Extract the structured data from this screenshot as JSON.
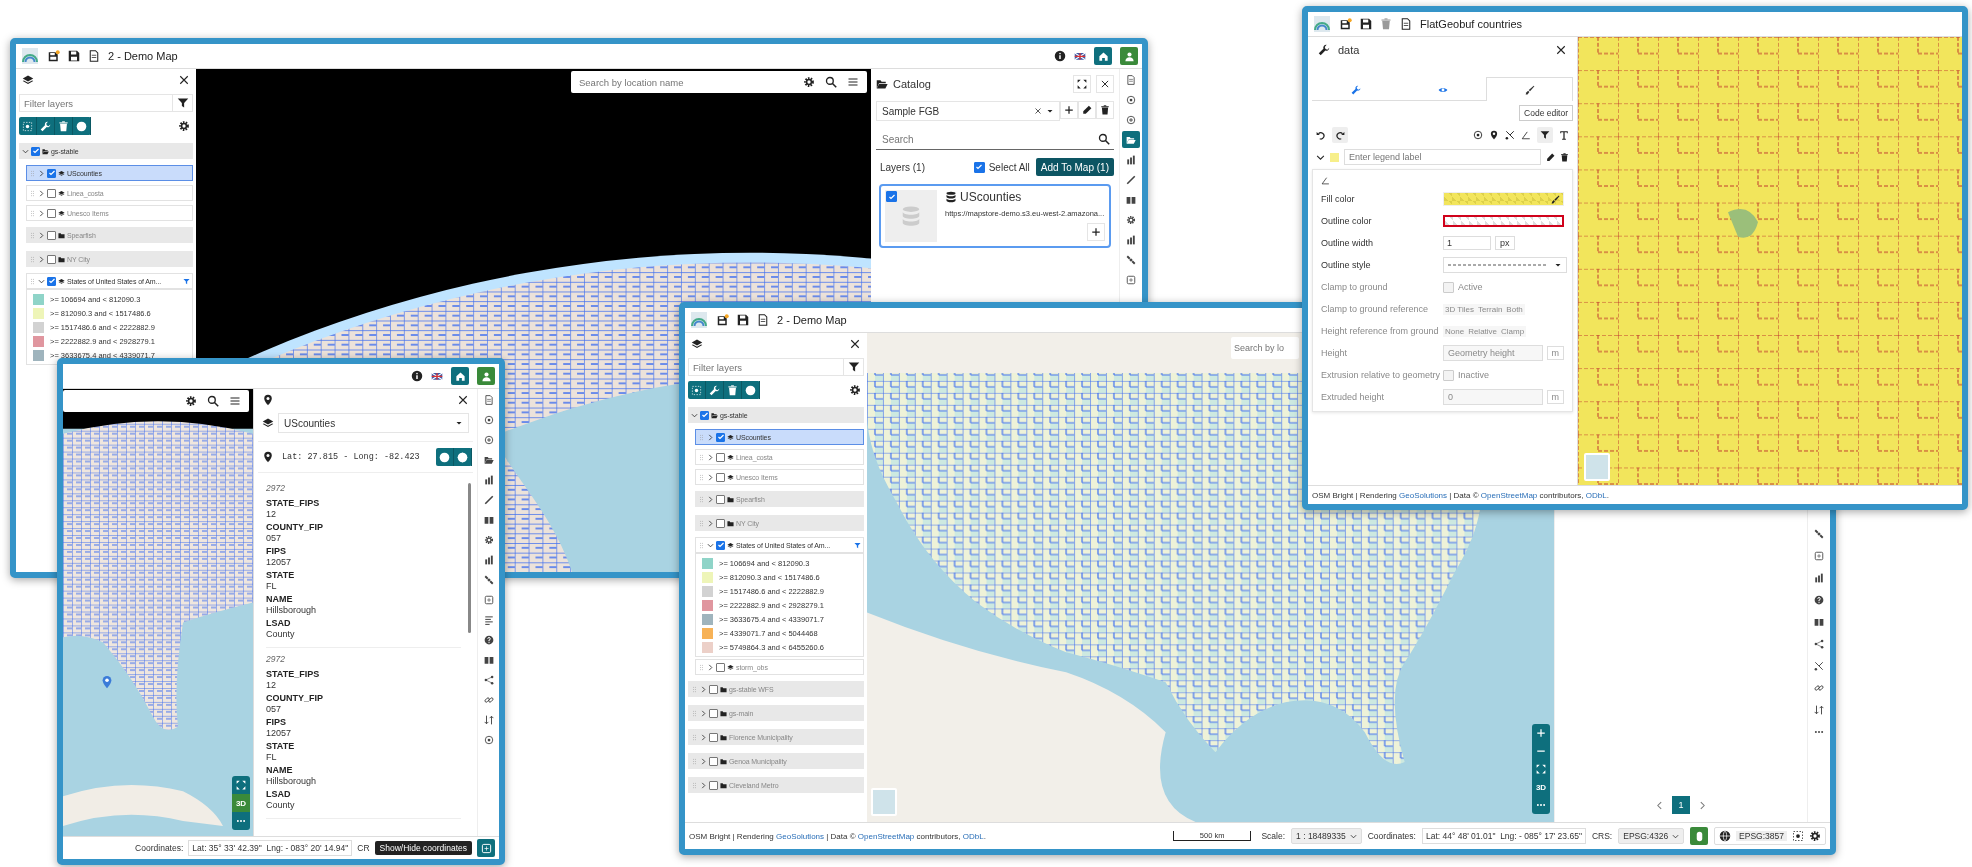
{
  "back_window": {
    "title": "2 - Demo Map",
    "filter_placeholder": "Filter layers",
    "layers": [
      {
        "label": "gs-stable",
        "kind": "group",
        "checked": true,
        "expanded": true,
        "selected": false,
        "filtered": false,
        "children": [
          {
            "label": "UScounties",
            "kind": "vector",
            "checked": true,
            "expanded": false,
            "selected": true,
            "filtered": false
          },
          {
            "label": "Linea_costa",
            "kind": "vector",
            "checked": false,
            "expanded": false,
            "selected": false,
            "filtered": false
          },
          {
            "label": "Unesco Items",
            "kind": "vector",
            "checked": false,
            "expanded": false,
            "selected": false,
            "filtered": false
          },
          {
            "label": "Spearfish",
            "kind": "folder",
            "checked": false,
            "expanded": false,
            "selected": false,
            "filtered": false
          },
          {
            "label": "NY City",
            "kind": "folder",
            "checked": false,
            "expanded": false,
            "selected": false,
            "filtered": false
          },
          {
            "label": "States of United States of Am...",
            "kind": "vector",
            "checked": true,
            "expanded": true,
            "selected": false,
            "filtered": true,
            "legend": [
              {
                "label": ">= 106694 and < 812090.3",
                "color": "#8fd4c8"
              },
              {
                "label": ">= 812090.3 and < 1517486.6",
                "color": "#eef5b8"
              },
              {
                "label": ">= 1517486.6 and < 2222882.9",
                "color": "#d2d2d2"
              },
              {
                "label": ">= 2222882.9 and < 2928279.1",
                "color": "#e0969f"
              },
              {
                "label": ">= 3633675.4 and < 4339071.7",
                "color": "#9fb4bd"
              }
            ]
          }
        ]
      }
    ],
    "search_placeholder": "Search by location name",
    "catalog": {
      "title": "Catalog",
      "service": "Sample FGB",
      "search_placeholder": "Search",
      "layers_count": "Layers (1)",
      "select_all_label": "Select All",
      "select_all_checked": true,
      "add_button": "Add To Map (1)",
      "records": [
        {
          "title": "UScounties",
          "url": "https://mapstore-demo.s3.eu-west-2.amazona...",
          "checked": true,
          "selected": true
        }
      ]
    },
    "toolbar": [
      {
        "selected": false
      },
      {
        "selected": false
      },
      {
        "selected": false
      },
      {
        "selected": true
      },
      {
        "selected": false
      },
      {
        "selected": false
      },
      {
        "selected": false
      },
      {
        "selected": false
      },
      {
        "selected": false
      },
      {
        "selected": false
      },
      {
        "selected": false
      }
    ]
  },
  "identify_window": {
    "layer": "UScounties",
    "position": "Lat: 27.815 - Long: -82.423",
    "features": [
      {
        "title": "2972",
        "fields": [
          {
            "name": "STATE_FIPS",
            "value": "12"
          },
          {
            "name": "COUNTY_FIP",
            "value": "057"
          },
          {
            "name": "FIPS",
            "value": "12057"
          },
          {
            "name": "STATE",
            "value": "FL"
          },
          {
            "name": "NAME",
            "value": "Hillsborough"
          },
          {
            "name": "LSAD",
            "value": "County"
          }
        ]
      },
      {
        "title": "2972",
        "fields": [
          {
            "name": "STATE_FIPS",
            "value": "12"
          },
          {
            "name": "COUNTY_FIP",
            "value": "057"
          },
          {
            "name": "FIPS",
            "value": "12057"
          },
          {
            "name": "STATE",
            "value": "FL"
          },
          {
            "name": "NAME",
            "value": "Hillsborough"
          },
          {
            "name": "LSAD",
            "value": "County"
          }
        ]
      }
    ],
    "view_toggle": "3D",
    "coordinates_label": "Coordinates:",
    "coordinates": "Lat: 35° 33' 42.39\"  Lng: - 083° 20' 14.94\"",
    "crs_label": "CR",
    "tooltip": "Show/Hide coordinates"
  },
  "front_window": {
    "title": "2 - Demo Map",
    "filter_placeholder": "Filter layers",
    "layers": [
      {
        "label": "gs-stable",
        "kind": "group",
        "checked": true,
        "expanded": true,
        "selected": false,
        "filtered": false,
        "children": [
          {
            "label": "UScounties",
            "kind": "vector",
            "checked": true,
            "expanded": false,
            "selected": true,
            "filtered": false
          },
          {
            "label": "Linea_costa",
            "kind": "vector",
            "checked": false,
            "expanded": false,
            "selected": false,
            "filtered": false
          },
          {
            "label": "Unesco Items",
            "kind": "vector",
            "checked": false,
            "expanded": false,
            "selected": false,
            "filtered": false
          },
          {
            "label": "Spearfish",
            "kind": "folder",
            "checked": false,
            "expanded": false,
            "selected": false,
            "filtered": false
          },
          {
            "label": "NY City",
            "kind": "folder",
            "checked": false,
            "expanded": false,
            "selected": false,
            "filtered": false
          },
          {
            "label": "States of United States of Am...",
            "kind": "vector",
            "checked": true,
            "expanded": true,
            "selected": false,
            "filtered": true,
            "legend": [
              {
                "label": ">= 106694 and < 812090.3",
                "color": "#8fd4c8"
              },
              {
                "label": ">= 812090.3 and < 1517486.6",
                "color": "#eef5b8"
              },
              {
                "label": ">= 1517486.6 and < 2222882.9",
                "color": "#d2d2d2"
              },
              {
                "label": ">= 2222882.9 and < 2928279.1",
                "color": "#e0969f"
              },
              {
                "label": ">= 3633675.4 and < 4339071.7",
                "color": "#9fb4bd"
              },
              {
                "label": ">= 4339071.7 and < 5044468",
                "color": "#f7b257"
              },
              {
                "label": ">= 5749864.3 and < 6455260.6",
                "color": "#ecd0c8"
              }
            ]
          },
          {
            "label": "storm_obs",
            "kind": "vector",
            "checked": false,
            "expanded": false,
            "selected": false,
            "filtered": false
          }
        ]
      },
      {
        "label": "gs-stable WFS",
        "kind": "folder",
        "checked": false,
        "expanded": false,
        "selected": false,
        "filtered": false
      },
      {
        "label": "gs-main",
        "kind": "folder",
        "checked": false,
        "expanded": false,
        "selected": false,
        "filtered": false
      },
      {
        "label": "Florence Municipality",
        "kind": "folder",
        "checked": false,
        "expanded": false,
        "selected": false,
        "filtered": false
      },
      {
        "label": "Genoa Municipality",
        "kind": "folder",
        "checked": false,
        "expanded": false,
        "selected": false,
        "filtered": false
      },
      {
        "label": "Cleveland Metro",
        "kind": "folder",
        "checked": false,
        "expanded": false,
        "selected": false,
        "filtered": false
      }
    ],
    "search_placeholder": "Search by lo",
    "view_toggle": "3D",
    "attribution": [
      {
        "text": "OSM Bright | Rendering ",
        "kind": "text"
      },
      {
        "text": "GeoSolutions",
        "kind": "link"
      },
      {
        "text": " | Data © ",
        "kind": "text"
      },
      {
        "text": "OpenStreetMap",
        "kind": "link"
      },
      {
        "text": " contributors, ",
        "kind": "text"
      },
      {
        "text": "ODbL",
        "kind": "link"
      },
      {
        "text": ".",
        "kind": "text"
      }
    ],
    "scale_bar": "500 km",
    "scale_label": "Scale:",
    "scale": "1 : 18489335",
    "coordinates_label": "Coordinates:",
    "coordinates": "Lat: 44° 48' 01.01\"  Lng: - 085° 17' 23.65\"",
    "crs_label": "CRS:",
    "crs": "EPSG:4326",
    "projection": "EPSG:3857",
    "pages": [
      {
        "label": "1",
        "selected": true
      }
    ]
  },
  "style_window": {
    "title": "FlatGeobuf countries",
    "panel_title": "data",
    "tabs": [
      {
        "selected": false
      },
      {
        "selected": false
      },
      {
        "selected": true
      }
    ],
    "tooltip": "Code editor",
    "rule": {
      "expanded": true,
      "color": "#f7ef8a",
      "legend_placeholder": "Enter legend label"
    },
    "fields": [
      {
        "label": "Fill color",
        "kind": "fill-color",
        "color": "#f2e55c",
        "disabled": false
      },
      {
        "label": "Outline color",
        "kind": "stroke-color",
        "color": "#d0021b",
        "disabled": false
      },
      {
        "label": "Outline width",
        "kind": "number",
        "value": "1",
        "unit": "px",
        "disabled": false
      },
      {
        "label": "Outline style",
        "kind": "dash-select",
        "disabled": false
      },
      {
        "label": "Clamp to ground",
        "kind": "checkbox",
        "option": "Active",
        "checked": false,
        "disabled": true
      },
      {
        "label": "Clamp to ground reference",
        "kind": "segmented",
        "options": [
          "3D Tiles",
          "Terrain",
          "Both"
        ],
        "disabled": true
      },
      {
        "label": "Height reference from ground",
        "kind": "segmented",
        "options": [
          "None",
          "Relative",
          "Clamp"
        ],
        "disabled": true
      },
      {
        "label": "Height",
        "kind": "input",
        "placeholder": "Geometry height",
        "unit": "m",
        "disabled": true
      },
      {
        "label": "Extrusion relative to geometry",
        "kind": "checkbox",
        "option": "Inactive",
        "checked": false,
        "disabled": true
      },
      {
        "label": "Extruded height",
        "kind": "input",
        "placeholder": "0",
        "unit": "m",
        "disabled": true
      }
    ],
    "attribution": [
      {
        "text": "OSM Bright | Rendering ",
        "kind": "text"
      },
      {
        "text": "GeoSolutions",
        "kind": "link"
      },
      {
        "text": " | Data © ",
        "kind": "text"
      },
      {
        "text": "OpenStreetMap",
        "kind": "link"
      },
      {
        "text": " contributors, ",
        "kind": "text"
      },
      {
        "text": "ODbL",
        "kind": "link"
      },
      {
        "text": ".",
        "kind": "text"
      }
    ]
  }
}
